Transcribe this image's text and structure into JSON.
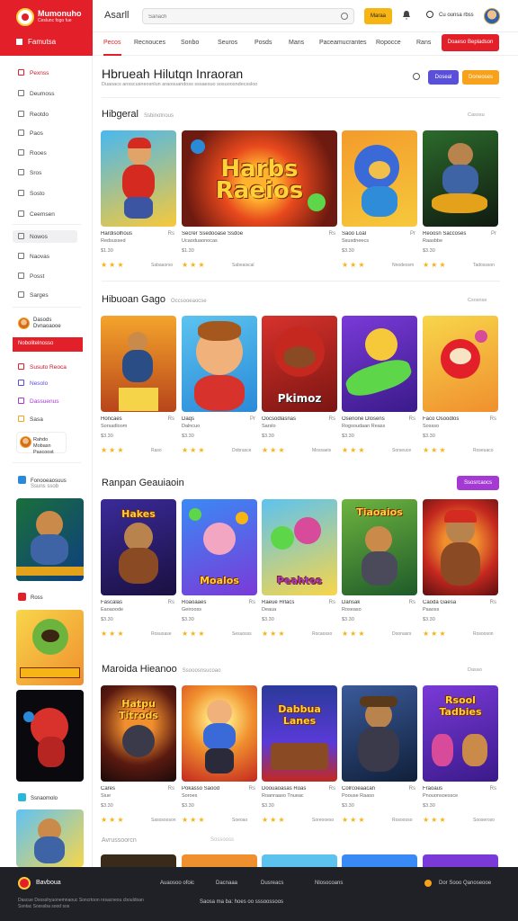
{
  "brand": {
    "name": "Mumonuho",
    "tagline": "Ceslunc fogo fue",
    "store_label": "Famutsa"
  },
  "topbar": {
    "app_title": "Asarll",
    "search_placeholder": "Sanach",
    "action_button": "Maraa",
    "user_label": "Cu ounsa rbss"
  },
  "categories": [
    "Pecos",
    "Recnouces",
    "Sonbo",
    "Seuros",
    "Posds",
    "Mans",
    "Paceamucrantes",
    "Ropocce",
    "Rans"
  ],
  "cta_button": "Doaeso Bepladson",
  "sidebar": {
    "items": [
      "Pexnss",
      "Deumoss",
      "Reotdo",
      "Paos",
      "Rooes",
      "Sros",
      "Sosto",
      "Ceemsen"
    ],
    "highlight_item": "Nowos",
    "items2": [
      "Naovas",
      "Posst",
      "Sarges"
    ],
    "profile_name": "Dasods",
    "profile_sub": "Dvnaoaooe",
    "active_bar": "Nobolitelnosso",
    "links": [
      "Susuto Reoca",
      "Nesolo",
      "Dassuenus",
      "Sasa"
    ],
    "promo": "Rahdo Mobasn",
    "promo_sub": "Pascoost",
    "side_heads": [
      "Fonooeaosuus",
      "Ross",
      "Ssnaomolo"
    ],
    "side_head_sub": "Ssuns ssob"
  },
  "hero": {
    "title": "Hbrueah Hilutqn Inraoran",
    "subtitle": "Duaoacs ansscusneosnlun araosuandoss sssaesuo sosuoosndecssloo",
    "btn_primary": "Doseal",
    "btn_secondary": "Doneoses"
  },
  "sections": [
    {
      "title": "Hibgeral",
      "subtitle": "Ssbinotnous",
      "right": "Casosu",
      "cards": [
        {
          "title": "Hardisolhous",
          "rank": "Rs",
          "dev": "Redsussed",
          "price": "$1.30",
          "stars": "★★★",
          "stars_label": "Sabaaorso",
          "art": "Hero"
        },
        {
          "title": "Secrer Ssedooase Ssdoe",
          "rank": "Rs",
          "dev": "Ucaoduaonocas",
          "price": "$1.30",
          "stars": "★★★",
          "stars_label": "Sabeaiscal",
          "art": "Harbs Raeios",
          "wide": true
        },
        {
          "title": "Saoo Loal",
          "rank": "Pr",
          "dev": "Ssusdneecs",
          "price": "$3.30",
          "stars": "★★★",
          "stars_label": "Nnodeosm",
          "art": ""
        },
        {
          "title": "Reoosn Saccoses",
          "rank": "Pr",
          "dev": "Raasbbe",
          "price": "$3.30",
          "stars": "★★★",
          "stars_label": "Tadossson",
          "art": ""
        }
      ]
    },
    {
      "title": "Hibuoan Gago",
      "subtitle": "Occsooeaocse",
      "right": "Csosnse",
      "cards": [
        {
          "title": "Honcaes",
          "rank": "Rs",
          "dev": "Sorsadloom",
          "price": "$3.30",
          "stars": "★★★",
          "stars_label": "Raso",
          "art": ""
        },
        {
          "title": "Daqs",
          "rank": "Pr",
          "dev": "Dalncuo",
          "price": "$3.30",
          "stars": "★★★",
          "stars_label": "Dobrasce",
          "art": ""
        },
        {
          "title": "Oocsodlasnas",
          "rank": "Rs",
          "dev": "Sarslo",
          "price": "$3.30",
          "stars": "★★★",
          "stars_label": "Mossaeis",
          "art": "Pkimoz"
        },
        {
          "title": "Osenone Dlosens",
          "rank": "Rs",
          "dev": "Rogsoudaan Reass",
          "price": "$3.30",
          "stars": "★★★",
          "stars_label": "Sorseuce",
          "art": ""
        },
        {
          "title": "Faco Osoodlos",
          "rank": "Rs",
          "dev": "Sossso",
          "price": "$3.30",
          "stars": "★★★",
          "stars_label": "Roseuaco",
          "art": ""
        }
      ]
    },
    {
      "title": "Ranpan Geauiaoin",
      "subtitle": "",
      "right": "",
      "button": "Ssosrcaocs",
      "cards": [
        {
          "title": "Fascalas",
          "rank": "Rs",
          "dev": "Eaoaoode",
          "price": "$3.30",
          "stars": "★★★",
          "stars_label": "Rosuoase",
          "art": "Hakes"
        },
        {
          "title": "Roaoaaes",
          "rank": "Rs",
          "dev": "Geirooss",
          "price": "$3.30",
          "stars": "★★★",
          "stars_label": "Sesuosss",
          "art": "Moalos"
        },
        {
          "title": "Raeue Hrlacs",
          "rank": "Rs",
          "dev": "Deaua",
          "price": "$3.30",
          "stars": "★★★",
          "stars_label": "Rocaosso",
          "art": "Peahtos"
        },
        {
          "title": "Dansak",
          "rank": "Rs",
          "dev": "Roseaso",
          "price": "$3.30",
          "stars": "★★★",
          "stars_label": "Doonasrs",
          "art": "Tiaoaios"
        },
        {
          "title": "Caoda Gaesa",
          "rank": "Rs",
          "dev": "Paaoss",
          "price": "$3.30",
          "stars": "★★★",
          "stars_label": "Rosooson",
          "art": ""
        }
      ]
    },
    {
      "title": "Maroida Hieanoo",
      "subtitle": "Ssooosnsucoao",
      "right": "Dasao",
      "cards": [
        {
          "title": "Cares",
          "rank": "Rs",
          "dev": "Siue",
          "price": "$3.30",
          "stars": "★★★",
          "stars_label": "Sasosooson",
          "art": "Hatpu Titrods"
        },
        {
          "title": "Pokasso Saood",
          "rank": "Rs",
          "dev": "Soroes",
          "price": "$3.30",
          "stars": "★★★",
          "stars_label": "Soeoao",
          "art": ""
        },
        {
          "title": "Doouaoasas Roas",
          "rank": "Rs",
          "dev": "Roanraaso Tnueac",
          "price": "$3.30",
          "stars": "★★★",
          "stars_label": "Soreooeso",
          "art": "Dabbua Lanes"
        },
        {
          "title": "Colrcoeaacan",
          "rank": "Rs",
          "dev": "Poouse Raaso",
          "price": "$3.30",
          "stars": "★★★",
          "stars_label": "Rosoooso",
          "art": ""
        },
        {
          "title": "Fraoaus",
          "rank": "Rs",
          "dev": "Pnouonsoessce",
          "price": "$3.30",
          "stars": "★★★",
          "stars_label": "Sooseroso",
          "art": "Rsool Tadbies"
        }
      ]
    }
  ],
  "peek": {
    "left": "Avrussoorcn",
    "right": "Sossooss"
  },
  "footer": {
    "name": "Bavboua",
    "copy": "Dascue Dsosshyuonemnaouc Soncrtoon nrsacneou cbouldoan Ssntac Sosssba sood sos",
    "links": [
      "Auaosoo ofoic",
      "Dacnaaa",
      "Dusreacs",
      "Nlosocoans"
    ],
    "bottom": "Saosa ma ba: hoes oo sssoossoos",
    "right": "Dor Sooo Qanoseooe"
  },
  "colors": {
    "accent": "#e3202a",
    "yellow": "#f7b514",
    "purple": "#5a4fd8",
    "orange": "#f7a21a",
    "magenta": "#a43ad3",
    "footer_bg": "#202126"
  }
}
